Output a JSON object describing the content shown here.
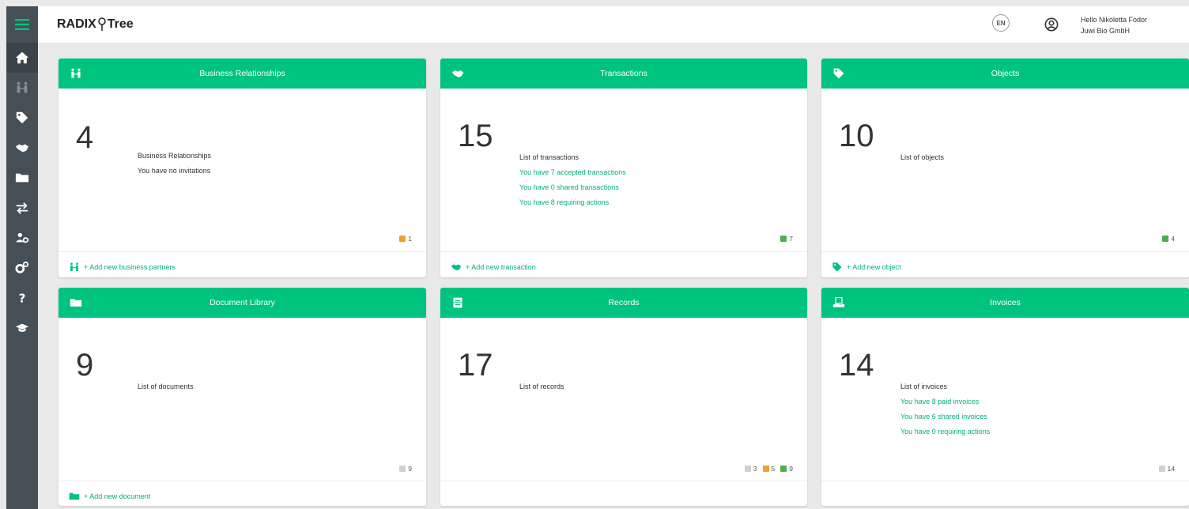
{
  "app": {
    "logo_left": "RADIX",
    "logo_right": "Tree"
  },
  "header": {
    "language": "EN",
    "greeting": "Hello Nikoletta Fodor",
    "company": "Juwi Bio GmbH"
  },
  "colors": {
    "accent": "#00c37f",
    "sidebar": "#454f58",
    "orange": "#f0a030",
    "green": "#4caf50",
    "grey": "#d0d0d0"
  },
  "sidebar": {
    "items": [
      {
        "icon": "home-icon"
      },
      {
        "icon": "business-relationships-icon"
      },
      {
        "icon": "tags-icon"
      },
      {
        "icon": "handshake-icon"
      },
      {
        "icon": "folder-icon"
      },
      {
        "icon": "exchange-icon"
      },
      {
        "icon": "users-settings-icon"
      },
      {
        "icon": "cogs-icon"
      },
      {
        "icon": "question-icon"
      },
      {
        "icon": "graduation-cap-icon"
      }
    ]
  },
  "cards": {
    "business": {
      "title": "Business Relationships",
      "count": "4",
      "lines": [
        "Business Relationships",
        "You have no invitations"
      ],
      "legend": [
        "1"
      ],
      "footer": "+ Add new business partners"
    },
    "transactions": {
      "title": "Transactions",
      "count": "15",
      "lines": [
        "List of transactions",
        "You have 7 accepted transactions",
        "You have 0 shared transactions",
        "You have 8 requiring actions"
      ],
      "legend": [
        "7"
      ],
      "footer": "+ Add new transaction"
    },
    "objects": {
      "title": "Objects",
      "count": "10",
      "lines": [
        "List of objects"
      ],
      "legend": [
        "4"
      ],
      "footer": "+ Add new object"
    },
    "documents": {
      "title": "Document Library",
      "count": "9",
      "lines": [
        "List of documents"
      ],
      "legend": [
        "9"
      ],
      "footer": "+ Add new document"
    },
    "records": {
      "title": "Records",
      "count": "17",
      "lines": [
        "List of records"
      ],
      "legend": [
        "3",
        "5",
        "9"
      ]
    },
    "invoices": {
      "title": "Invoices",
      "count": "14",
      "lines": [
        "List of invoices",
        "You have 8 paid invoices",
        "You have 6 shared invoices",
        "You have 0 requiring actions"
      ],
      "legend": [
        "14"
      ]
    }
  }
}
